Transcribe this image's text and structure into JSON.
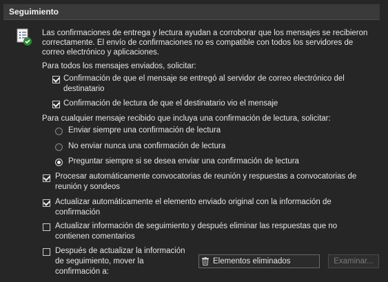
{
  "section": {
    "title": "Seguimiento"
  },
  "intro": {
    "line1": "Las confirmaciones de entrega y lectura ayudan a corroborar que los mensajes se recibieron",
    "line2": "correctamente. El envío de confirmaciones no es compatible con todos los servidores de",
    "line3": "correo electrónico y aplicaciones."
  },
  "sent_group": {
    "heading": "Para todos los mensajes enviados, solicitar:",
    "delivery": {
      "line1": "Confirmación de que el mensaje se entregó al servidor de correo electrónico del",
      "line2": "destinatario",
      "checked": true
    },
    "read": {
      "label": "Confirmación de lectura de que el destinatario vio el mensaje",
      "checked": true
    }
  },
  "received_group": {
    "heading": "Para cualquier mensaje recibido que incluya una confirmación de lectura, solicitar:",
    "options": [
      {
        "label": "Enviar siempre una confirmación de lectura",
        "checked": false
      },
      {
        "label": "No enviar nunca una confirmación de lectura",
        "checked": false
      },
      {
        "label": "Preguntar siempre si se desea enviar una confirmación de lectura",
        "checked": true
      }
    ]
  },
  "options": {
    "process_meeting": {
      "line1": "Procesar automáticamente convocatorias de reunión y respuestas a convocatorias de",
      "line2": "reunión y sondeos",
      "checked": true
    },
    "update_original": {
      "line1": "Actualizar automáticamente el elemento enviado original con la información de",
      "line2": "confirmación",
      "checked": true
    },
    "update_delete": {
      "line1": "Actualizar información de seguimiento y después eliminar las respuestas que no",
      "line2": "contienen comentarios",
      "checked": false
    },
    "move_after": {
      "line1": "Después de actualizar la información",
      "line2": "de seguimiento, mover la",
      "line3": "confirmación a:",
      "checked": false
    }
  },
  "folder": {
    "name": "Elementos eliminados",
    "icon": "trash-icon"
  },
  "browse_button": {
    "label": "Examinar..."
  },
  "colors": {
    "background": "#262626",
    "header": "#3a3a3a",
    "text": "#e6e6e6"
  }
}
